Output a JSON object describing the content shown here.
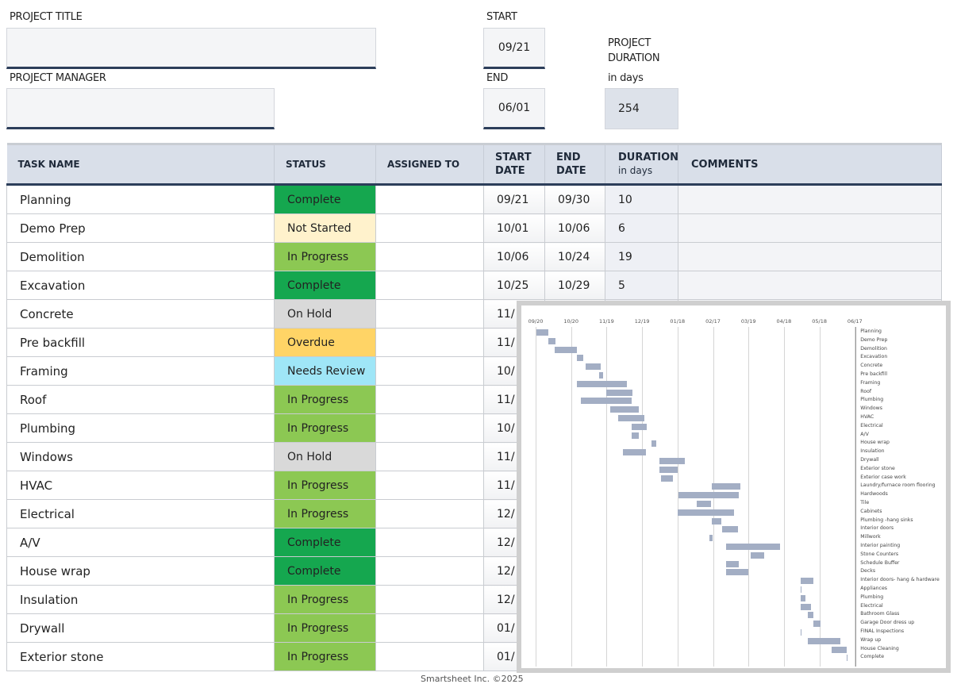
{
  "header": {
    "project_title_label": "PROJECT TITLE",
    "project_title_value": "",
    "project_manager_label": "PROJECT MANAGER",
    "project_manager_value": "",
    "start_label": "START",
    "start_value": "09/21",
    "end_label": "END",
    "end_value": "06/01",
    "duration_label_1": "PROJECT",
    "duration_label_2": "DURATION",
    "duration_label_3": "in days",
    "duration_value": "254"
  },
  "table": {
    "columns": {
      "task": "TASK NAME",
      "status": "STATUS",
      "assigned": "ASSIGNED TO",
      "start_1": "START",
      "start_2": "DATE",
      "end_1": "END",
      "end_2": "DATE",
      "duration_1": "DURATION",
      "duration_2": "in days",
      "comments": "COMMENTS"
    },
    "rows": [
      {
        "task": "Planning",
        "status": "Complete",
        "start": "09/21",
        "end": "09/30",
        "duration": "10"
      },
      {
        "task": "Demo Prep",
        "status": "Not Started",
        "start": "10/01",
        "end": "10/06",
        "duration": "6"
      },
      {
        "task": "Demolition",
        "status": "In Progress",
        "start": "10/06",
        "end": "10/24",
        "duration": "19"
      },
      {
        "task": "Excavation",
        "status": "Complete",
        "start": "10/25",
        "end": "10/29",
        "duration": "5"
      },
      {
        "task": "Concrete",
        "status": "On Hold",
        "start": "11/"
      },
      {
        "task": "Pre backfill",
        "status": "Overdue",
        "start": "11/"
      },
      {
        "task": "Framing",
        "status": "Needs Review",
        "start": "10/"
      },
      {
        "task": "Roof",
        "status": "In Progress",
        "start": "11/"
      },
      {
        "task": "Plumbing",
        "status": "In Progress",
        "start": "10/"
      },
      {
        "task": "Windows",
        "status": "On Hold",
        "start": "11/"
      },
      {
        "task": "HVAC",
        "status": "In Progress",
        "start": "11/"
      },
      {
        "task": "Electrical",
        "status": "In Progress",
        "start": "12/"
      },
      {
        "task": "A/V",
        "status": "Complete",
        "start": "12/"
      },
      {
        "task": "House wrap",
        "status": "Complete",
        "start": "12/"
      },
      {
        "task": "Insulation",
        "status": "In Progress",
        "start": "12/"
      },
      {
        "task": "Drywall",
        "status": "In Progress",
        "start": "01/"
      },
      {
        "task": "Exterior stone",
        "status": "In Progress",
        "start": "01/"
      }
    ]
  },
  "status_colors": {
    "Complete": "#15a74f",
    "Not Started": "#fff2cc",
    "In Progress": "#8cc853",
    "On Hold": "#d9d9d9",
    "Overdue": "#ffd466",
    "Needs Review": "#9fe6f7"
  },
  "footer": "Smartsheet Inc. ©2025",
  "chart_data": {
    "type": "gantt",
    "x_unit": "days from 09/20",
    "xlim": [
      0,
      270
    ],
    "ticks": [
      {
        "label": "09/20",
        "day": 0
      },
      {
        "label": "10/20",
        "day": 30
      },
      {
        "label": "11/19",
        "day": 60
      },
      {
        "label": "12/19",
        "day": 90
      },
      {
        "label": "01/18",
        "day": 120
      },
      {
        "label": "02/17",
        "day": 150
      },
      {
        "label": "03/19",
        "day": 180
      },
      {
        "label": "04/18",
        "day": 210
      },
      {
        "label": "05/18",
        "day": 240
      },
      {
        "label": "06/17",
        "day": 270
      }
    ],
    "bar_color": "#a3aec4",
    "tasks": [
      {
        "name": "Planning",
        "start": 1,
        "duration": 10
      },
      {
        "name": "Demo Prep",
        "start": 11,
        "duration": 6
      },
      {
        "name": "Demolition",
        "start": 16,
        "duration": 19
      },
      {
        "name": "Excavation",
        "start": 35,
        "duration": 5
      },
      {
        "name": "Concrete",
        "start": 42,
        "duration": 13
      },
      {
        "name": "Pre backfill",
        "start": 54,
        "duration": 3
      },
      {
        "name": "Framing",
        "start": 35,
        "duration": 42
      },
      {
        "name": "Roof",
        "start": 60,
        "duration": 22
      },
      {
        "name": "Plumbing",
        "start": 38,
        "duration": 43
      },
      {
        "name": "Windows",
        "start": 63,
        "duration": 24
      },
      {
        "name": "HVAC",
        "start": 70,
        "duration": 22
      },
      {
        "name": "Electrical",
        "start": 81,
        "duration": 13
      },
      {
        "name": "A/V",
        "start": 81,
        "duration": 6
      },
      {
        "name": "House wrap",
        "start": 98,
        "duration": 4
      },
      {
        "name": "Insulation",
        "start": 74,
        "duration": 19
      },
      {
        "name": "Drywall",
        "start": 105,
        "duration": 21
      },
      {
        "name": "Exterior stone",
        "start": 105,
        "duration": 15
      },
      {
        "name": "Exterior case work",
        "start": 106,
        "duration": 10
      },
      {
        "name": "Laundry/furnace room flooring",
        "start": 149,
        "duration": 24
      },
      {
        "name": "Hardwoods",
        "start": 121,
        "duration": 51
      },
      {
        "name": "Tile",
        "start": 136,
        "duration": 12
      },
      {
        "name": "Cabinets",
        "start": 120,
        "duration": 48
      },
      {
        "name": "Plumbing -hang sinks",
        "start": 149,
        "duration": 8
      },
      {
        "name": "Interior doors",
        "start": 158,
        "duration": 13
      },
      {
        "name": "Millwork",
        "start": 147,
        "duration": 3
      },
      {
        "name": "Interior painting",
        "start": 161,
        "duration": 46
      },
      {
        "name": "Stone Counters",
        "start": 182,
        "duration": 11
      },
      {
        "name": "Schedule Buffer",
        "start": 161,
        "duration": 11
      },
      {
        "name": "Decks",
        "start": 161,
        "duration": 19
      },
      {
        "name": "Interior doors- hang & hardware",
        "start": 224,
        "duration": 11
      },
      {
        "name": "Appliances",
        "start": 224,
        "duration": 1
      },
      {
        "name": "Plumbing",
        "start": 224,
        "duration": 4
      },
      {
        "name": "Electrical",
        "start": 224,
        "duration": 9
      },
      {
        "name": "Bathroom Glass",
        "start": 230,
        "duration": 5
      },
      {
        "name": "Garage Door dress up",
        "start": 235,
        "duration": 6
      },
      {
        "name": "FINAL Inspections",
        "start": 224,
        "duration": 0
      },
      {
        "name": "Wrap up",
        "start": 230,
        "duration": 28
      },
      {
        "name": "House Cleaning",
        "start": 250,
        "duration": 13
      },
      {
        "name": "Complete",
        "start": 263,
        "duration": 0
      }
    ]
  }
}
